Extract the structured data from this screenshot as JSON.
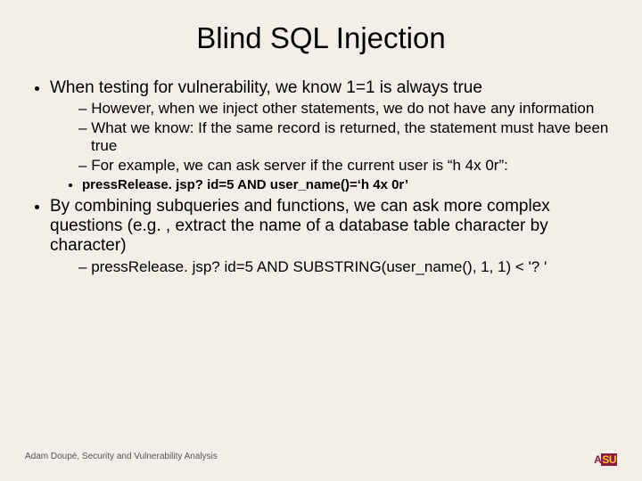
{
  "title": "Blind SQL Injection",
  "bullets": {
    "b1": "When testing for vulnerability, we know 1=1 is always true",
    "b1_sub": {
      "s1": "However, when we inject other statements, we do not have any information",
      "s2": "What we know: If the same record is returned, the statement must have been true",
      "s3": "For example, we can ask server if the current user is “h 4x 0r”:",
      "s3_code": "pressRelease. jsp? id=5 AND user_name()=‘h 4x 0r’"
    },
    "b2": "By combining subqueries and functions, we can ask more complex questions (e.g. , extract the name of a database table character by character)",
    "b2_sub": {
      "s1": "pressRelease. jsp? id=5 AND SUBSTRING(user_name(), 1, 1) < '? '"
    }
  },
  "footer": "Adam Doupé, Security and Vulnerability Analysis",
  "logo": {
    "a": "A",
    "su": "SU"
  }
}
